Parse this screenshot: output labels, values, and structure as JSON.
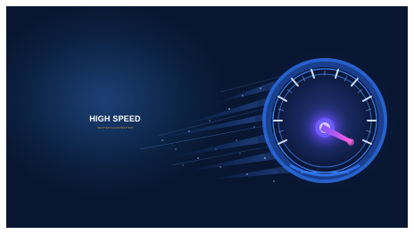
{
  "poster": {
    "headline": "HIGH SPEED",
    "subline": "VECTOR ILLUSTRATION"
  },
  "colors": {
    "background_dark": "#081631",
    "background_glow": "#1c3f75",
    "headline": "#ffffff",
    "subline": "#e2a243",
    "gauge_blue": "#2f7bff",
    "needle_pink": "#ff4fd8"
  },
  "gauge": {
    "icon": "speedometer-icon",
    "needle": "needle-icon"
  }
}
